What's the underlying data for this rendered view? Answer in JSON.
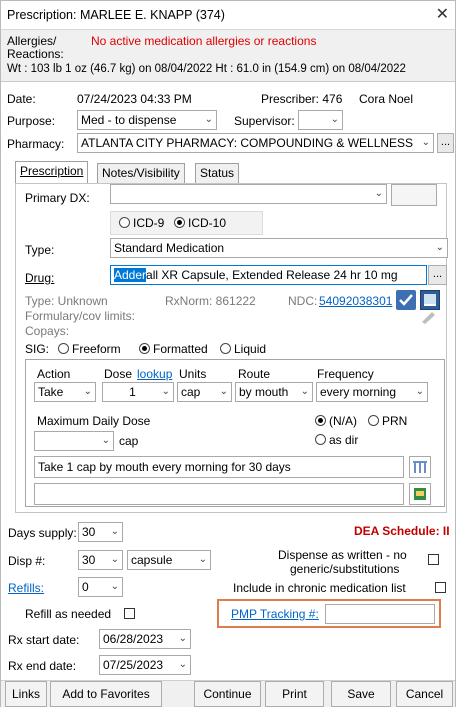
{
  "window": {
    "title": "Prescription: MARLEE E. KNAPP (374)",
    "close_glyph": "✕"
  },
  "header": {
    "allergies_label_1": "Allergies/",
    "allergies_label_2": "Reactions:",
    "allergies_value": "No active medication allergies or reactions",
    "vitals": "Wt : 103 lb 1 oz (46.7 kg) on 08/04/2022   Ht : 61.0 in (154.9 cm) on 08/04/2022"
  },
  "form": {
    "date_label": "Date:",
    "date_value": "07/24/2023 04:33 PM",
    "prescriber_label": "Prescriber: 476",
    "prescriber_name": "Cora Noel",
    "purpose_label": "Purpose:",
    "purpose_value": "Med - to dispense",
    "supervisor_label": "Supervisor:",
    "supervisor_value": "",
    "pharmacy_label": "Pharmacy:",
    "pharmacy_value": "ATLANTA CITY PHARMACY: COMPOUNDING & WELLNESS",
    "pharmacy_more": "..."
  },
  "tabs": [
    {
      "label": "Prescription"
    },
    {
      "label": "Notes/Visibility"
    },
    {
      "label": "Status"
    }
  ],
  "rx": {
    "primary_dx_label": "Primary DX:",
    "primary_dx_value": "",
    "icd9": "ICD-9",
    "icd10": "ICD-10",
    "type_label": "Type:",
    "type_value": "Standard Medication",
    "drug_label": "Drug:",
    "drug_highlight": "Adder",
    "drug_rest": "all XR Capsule, Extended Release 24 hr 10 mg",
    "drug_more": "...",
    "type_unknown": "Type:  Unknown",
    "rxnorm": "RxNorm: 861222",
    "ndc_label": "NDC:",
    "ndc_value": "54092038301",
    "formulary": "Formulary/cov limits:",
    "copays": "Copays:",
    "sig_label": "SIG:",
    "sig_freeform": "Freeform",
    "sig_formatted": "Formatted",
    "sig_liquid": "Liquid"
  },
  "sig": {
    "action_h": "Action",
    "dose_h": "Dose",
    "lookup": "lookup",
    "units_h": "Units",
    "route_h": "Route",
    "freq_h": "Frequency",
    "action": "Take",
    "dose": "1",
    "units": "cap",
    "route": "by mouth",
    "freq": "every morning",
    "max_daily_label": "Maximum Daily Dose",
    "max_daily_value": "",
    "max_units": "cap",
    "na": "(N/A)",
    "prn": "PRN",
    "as_dir": "as dir",
    "sig_text": "Take 1 cap by mouth every morning for 30 days",
    "sig_extra": ""
  },
  "supply": {
    "days_label": "Days supply:",
    "days_value": "30",
    "dea": "DEA Schedule: II",
    "disp_label": "Disp #:",
    "disp_value": "30",
    "disp_unit": "capsule",
    "daw_1": "Dispense as written - no",
    "daw_2": "generic/substitutions",
    "refills_label": "Refills:",
    "refills_value": "0",
    "chronic": "Include in chronic medication list",
    "refill_needed": "Refill as needed",
    "pmp_label": "PMP Tracking #:",
    "pmp_value": "",
    "start_label": "Rx start date:",
    "start_value": "06/28/2023",
    "end_label": "Rx end date:",
    "end_value": "07/25/2023"
  },
  "footer": {
    "links": "Links",
    "favorites": "Add to Favorites",
    "continue": "Continue",
    "print": "Print",
    "save": "Save",
    "cancel": "Cancel"
  },
  "colors": {
    "accent_border": "#e07b4b",
    "link": "#0063c6",
    "alert": "#e00000",
    "highlight": "#0078d7"
  }
}
